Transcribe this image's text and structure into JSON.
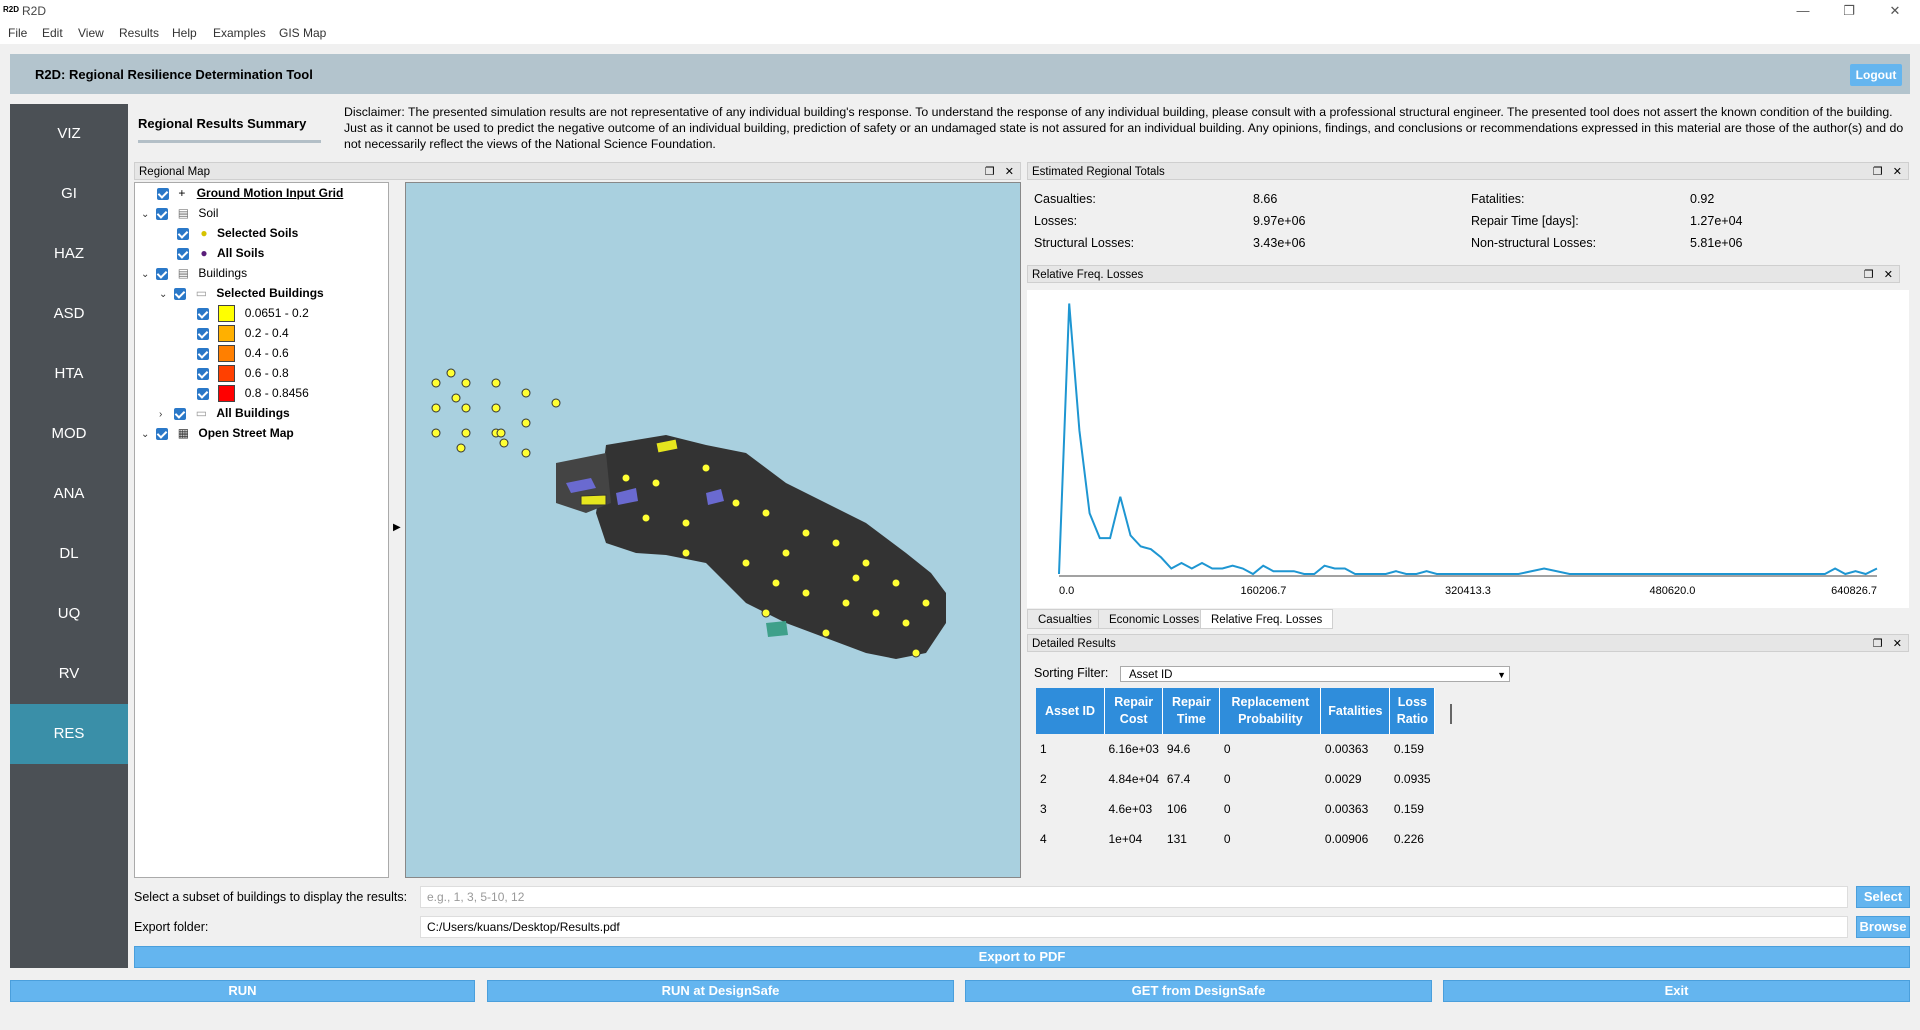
{
  "window": {
    "title": "R2D",
    "icon_text": "R2D",
    "buttons": [
      "—",
      "❐",
      "✕"
    ]
  },
  "menu": [
    "File",
    "Edit",
    "View",
    "Results",
    "Help",
    "Examples",
    "GIS Map"
  ],
  "header": {
    "title": "R2D: Regional Resilience Determination Tool",
    "logout": "Logout"
  },
  "nav": [
    "VIZ",
    "GI",
    "HAZ",
    "ASD",
    "HTA",
    "MOD",
    "ANA",
    "DL",
    "UQ",
    "RV",
    "RES"
  ],
  "nav_active": "RES",
  "summary_tab": "Regional Results Summary",
  "disclaimer": "Disclaimer: The presented simulation results are not representative of any individual building's response. To understand the response of any individual building, please consult with a professional structural engineer. The presented tool does not assert the known condition of the building. Just as it cannot be used to predict the negative outcome of an individual building, prediction of safety or an undamaged state is not assured for an individual building. Any opinions, findings, and conclusions or recommendations expressed in this material are those of the author(s) and do not necessarily reflect the views of the National Science Foundation.",
  "regional_map": {
    "title": "Regional Map",
    "layers": {
      "ground_motion": "Ground Motion Input Grid",
      "soil": "Soil",
      "selected_soils": "Selected Soils",
      "all_soils": "All Soils",
      "buildings": "Buildings",
      "selected_buildings": "Selected Buildings",
      "ranges": [
        "0.0651 - 0.2",
        "0.2 - 0.4",
        "0.4 - 0.6",
        "0.6 - 0.8",
        "0.8 - 0.8456"
      ],
      "range_colors": [
        "#ffff00",
        "#ffb000",
        "#ff7f00",
        "#ff4000",
        "#ff0000"
      ],
      "all_buildings": "All Buildings",
      "osm": "Open Street Map"
    }
  },
  "totals": {
    "title": "Estimated Regional Totals",
    "casualties_label": "Casualties:",
    "casualties": "8.66",
    "fatalities_label": "Fatalities:",
    "fatalities": "0.92",
    "losses_label": "Losses:",
    "losses": "9.97e+06",
    "repair_time_label": "Repair Time [days]:",
    "repair_time": "1.27e+04",
    "structural_label": "Structural Losses:",
    "structural": "3.43e+06",
    "nonstructural_label": "Non-structural Losses:",
    "nonstructural": "5.81e+06"
  },
  "histogram": {
    "title": "Relative Freq. Losses",
    "tabs": [
      "Casualties",
      "Economic Losses",
      "Relative Freq. Losses"
    ],
    "active_tab": "Relative Freq. Losses"
  },
  "chart_data": {
    "type": "line",
    "title": "",
    "xlabel": "",
    "ylabel": "",
    "x_ticks": [
      "0.0",
      "160206.7",
      "320413.3",
      "480620.0",
      "640826.7"
    ],
    "xlim": [
      0,
      640826.7
    ],
    "ylim": [
      0,
      1
    ],
    "color": "#1e96d2",
    "x": [
      0,
      8000,
      16000,
      24000,
      32000,
      40000,
      48000,
      56000,
      64000,
      72000,
      80000,
      88000,
      96000,
      104000,
      112000,
      120000,
      128000,
      136000,
      144000,
      152000,
      160000,
      168000,
      176000,
      184000,
      192000,
      200000,
      208000,
      216000,
      224000,
      232000,
      240000,
      248000,
      256000,
      264000,
      272000,
      280000,
      288000,
      296000,
      304000,
      312000,
      320000,
      340000,
      360000,
      380000,
      400000,
      420000,
      440000,
      460000,
      480000,
      500000,
      520000,
      540000,
      560000,
      580000,
      600000,
      608000,
      616000,
      624000,
      632000,
      640826
    ],
    "y": [
      0.0,
      0.98,
      0.52,
      0.22,
      0.13,
      0.13,
      0.28,
      0.14,
      0.1,
      0.09,
      0.06,
      0.02,
      0.04,
      0.02,
      0.04,
      0.02,
      0.02,
      0.03,
      0.02,
      0.0,
      0.03,
      0.01,
      0.01,
      0.01,
      0.0,
      0.0,
      0.03,
      0.02,
      0.02,
      0.0,
      0.0,
      0.0,
      0.0,
      0.01,
      0.0,
      0.0,
      0.01,
      0.0,
      0.0,
      0.0,
      0.0,
      0.0,
      0.0,
      0.02,
      0.0,
      0.0,
      0.0,
      0.0,
      0.0,
      0.0,
      0.0,
      0.0,
      0.0,
      0.0,
      0.0,
      0.02,
      0.0,
      0.01,
      0.0,
      0.02
    ]
  },
  "detailed": {
    "title": "Detailed Results",
    "sorting_label": "Sorting Filter:",
    "sorting_value": "Asset ID",
    "columns": [
      "Asset ID",
      "Repair Cost",
      "Repair Time",
      "Replacement Probability",
      "Fatalities",
      "Loss Ratio"
    ],
    "rows": [
      [
        "1",
        "6.16e+03",
        "94.6",
        "0",
        "0.00363",
        "0.159"
      ],
      [
        "2",
        "4.84e+04",
        "67.4",
        "0",
        "0.0029",
        "0.0935"
      ],
      [
        "3",
        "4.6e+03",
        "106",
        "0",
        "0.00363",
        "0.159"
      ],
      [
        "4",
        "1e+04",
        "131",
        "0",
        "0.00906",
        "0.226"
      ]
    ]
  },
  "subset": {
    "label": "Select a subset of buildings to display the results:",
    "placeholder": "e.g., 1, 3, 5-10, 12",
    "button": "Select"
  },
  "export": {
    "label": "Export folder:",
    "value": "C:/Users/kuans/Desktop/Results.pdf",
    "browse": "Browse",
    "export_pdf": "Export to PDF"
  },
  "bottom_buttons": [
    "RUN",
    "RUN at DesignSafe",
    "GET from DesignSafe",
    "Exit"
  ]
}
